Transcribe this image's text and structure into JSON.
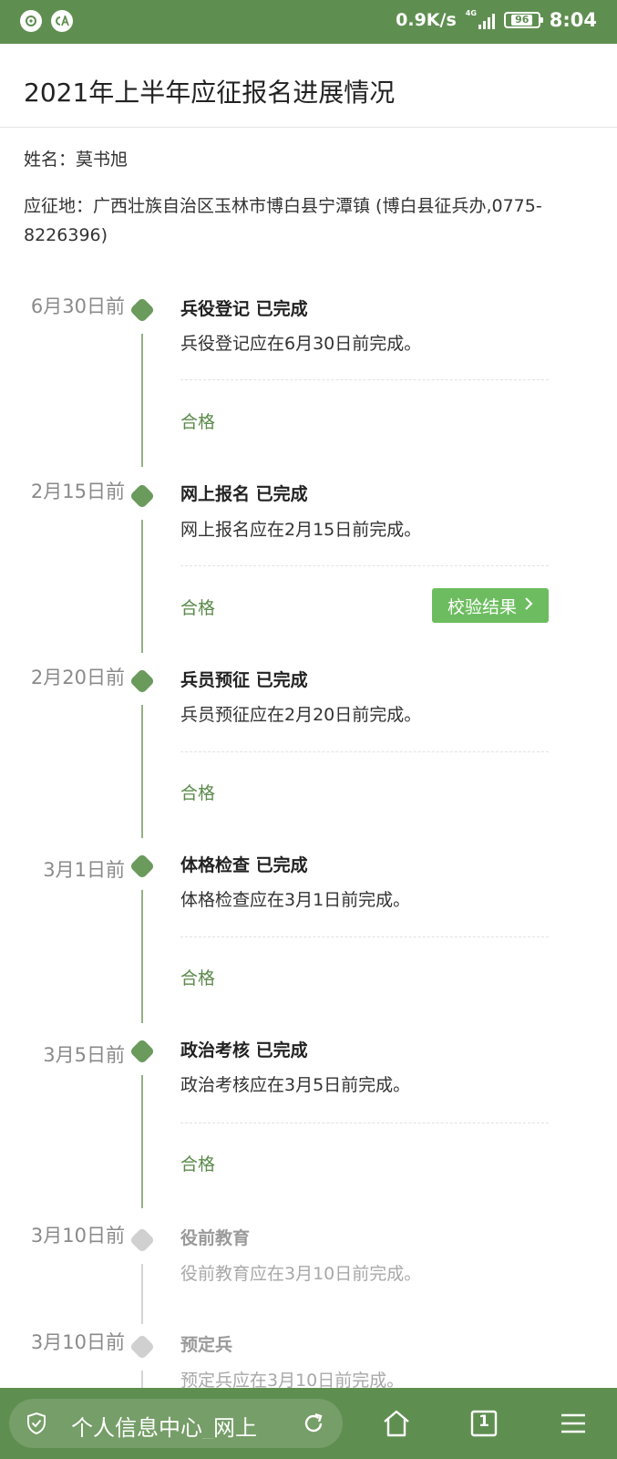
{
  "status_bar": {
    "network_speed": "0.9K/s",
    "network_type": "4G",
    "battery": "96",
    "time": "8:04",
    "app_icons": [
      "netease-music-icon",
      "ca-app-icon"
    ]
  },
  "page": {
    "title": "2021年上半年应征报名进展情况",
    "name_line": "姓名：莫书旭",
    "location_line": "应征地：广西壮族自治区玉林市博白县宁潭镇 (博白县征兵办,0775-8226396)"
  },
  "timeline": [
    {
      "date": "6月30日前",
      "title": "兵役登记 已完成",
      "desc": "兵役登记应在6月30日前完成。",
      "result": "合格",
      "status": "done"
    },
    {
      "date": "2月15日前",
      "title": "网上报名 已完成",
      "desc": "网上报名应在2月15日前完成。",
      "result": "合格",
      "button": "校验结果",
      "status": "done"
    },
    {
      "date": "2月20日前",
      "title": "兵员预征 已完成",
      "desc": "兵员预征应在2月20日前完成。",
      "result": "合格",
      "status": "done"
    },
    {
      "date": "3月1日前",
      "title": "体格检查 已完成",
      "desc": "体格检查应在3月1日前完成。",
      "result": "合格",
      "status": "done"
    },
    {
      "date": "3月5日前",
      "title": "政治考核 已完成",
      "desc": "政治考核应在3月5日前完成。",
      "result": "合格",
      "status": "done"
    },
    {
      "date": "3月10日前",
      "title": "役前教育",
      "desc": "役前教育应在3月10日前完成。",
      "status": "pending"
    },
    {
      "date": "3月10日前",
      "title": "预定兵",
      "desc": "预定兵应在3月10日前完成。",
      "status": "pending"
    }
  ],
  "browser_bar": {
    "url_title": "个人信息中心_网上",
    "tab_count": "1"
  },
  "colors": {
    "accent": "#5f8f50",
    "done_dot": "#6a9a5c",
    "pending_dot": "#d0d0d0",
    "result_text": "#5a8a4a",
    "button": "#6dbd60"
  }
}
